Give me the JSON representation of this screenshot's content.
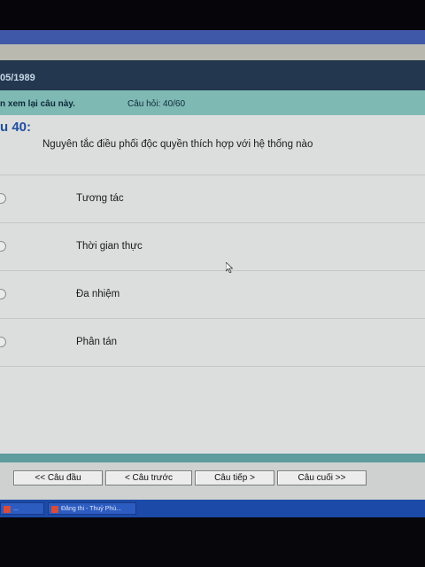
{
  "header": {
    "date_text": "05/1989"
  },
  "info_bar": {
    "review_text": "n xem lại câu này.",
    "counter_text": "Câu hỏi: 40/60"
  },
  "question": {
    "number_text": "u 40:",
    "text": "Nguyên tắc điều phối độc quyền thích hợp với  hệ thống nào"
  },
  "options": [
    {
      "label": "Tương tác"
    },
    {
      "label": "Thời gian thực"
    },
    {
      "label": "Đa nhiệm"
    },
    {
      "label": "Phân tán"
    }
  ],
  "nav": {
    "first_label": "<< Câu đầu",
    "prev_label": "< Câu trước",
    "next_label": "Câu tiếp >",
    "last_label": "Câu cuối >>"
  },
  "taskbar": {
    "item1_label": "...",
    "item2_label": "Đăng thi - Thuỷ Phù..."
  },
  "colors": {
    "header_bg": "#23384f",
    "info_bar_bg": "#7fb9b4",
    "question_number": "#1f4fa0",
    "content_bg": "#dcdedd",
    "taskbar_bg": "#1c4aa8"
  },
  "icons": {
    "cursor": "mouse-pointer-icon",
    "option_marker": "radio-button-icon"
  }
}
